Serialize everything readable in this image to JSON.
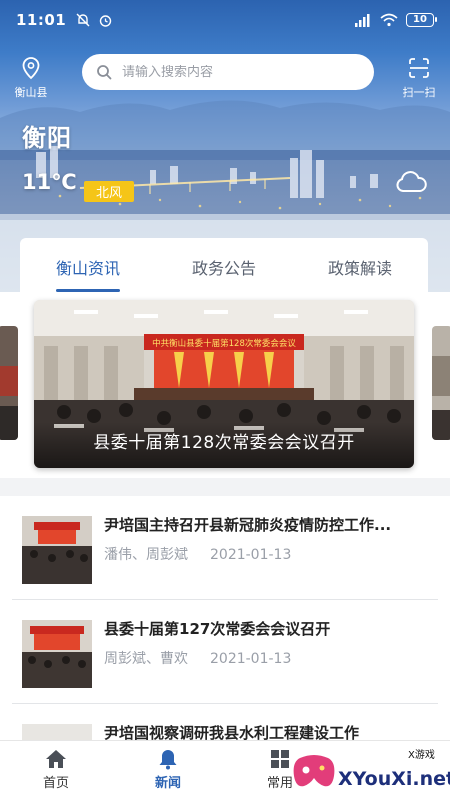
{
  "status": {
    "time": "11:01",
    "battery": "10"
  },
  "header": {
    "location_label": "衡山县",
    "search_placeholder": "请输入搜索内容",
    "scan_label": "扫一扫"
  },
  "weather": {
    "city": "衡阳",
    "temperature": "11℃",
    "wind": "北风",
    "icon": "cloud-icon"
  },
  "tabs": [
    {
      "label": "衡山资讯",
      "active": true
    },
    {
      "label": "政务公告",
      "active": false
    },
    {
      "label": "政策解读",
      "active": false
    }
  ],
  "carousel": {
    "caption": "县委十届第128次常委会会议召开",
    "banner_text": "中共衡山县委十届第128次常委会会议"
  },
  "news": [
    {
      "title": "尹培国主持召开县新冠肺炎疫情防控工作...",
      "authors": "潘伟、周彭斌",
      "date": "2021-01-13"
    },
    {
      "title": "县委十届第127次常委会会议召开",
      "authors": "周彭斌、曹欢",
      "date": "2021-01-13"
    },
    {
      "title": "尹培国视察调研我县水利工程建设工作",
      "authors": "",
      "date": ""
    }
  ],
  "bottom_nav": [
    {
      "label": "首页",
      "icon": "home-icon",
      "active": false
    },
    {
      "label": "新闻",
      "icon": "bell-icon",
      "active": true
    },
    {
      "label": "常用",
      "icon": "grid-icon",
      "active": false
    }
  ],
  "watermark": {
    "text": "XYouXi.net",
    "small": "X游戏"
  },
  "colors": {
    "accent": "#2d64b3",
    "wind_badge": "#f5c518",
    "banner_red": "#d8332a"
  }
}
